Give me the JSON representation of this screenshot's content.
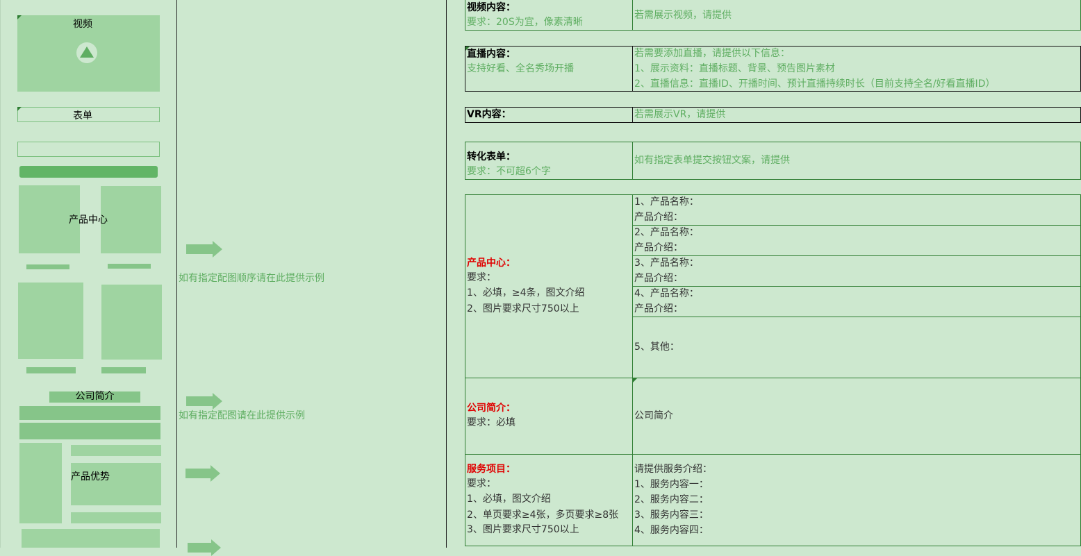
{
  "left": {
    "video_label": "视频",
    "form_label": "表单",
    "product_center_label": "产品中心",
    "company_label": "公司简介",
    "advantage_label": "产品优势"
  },
  "middle": {
    "note_1": "如有指定配图顺序请在此提供示例",
    "note_2": "如有指定配图请在此提供示例"
  },
  "rows": {
    "video": {
      "title": "视频内容：",
      "req": "要求：20S为宜，像素清晰",
      "note": "若需展示视频，请提供"
    },
    "live": {
      "title": "直播内容：",
      "req": "支持好看、全名秀场开播",
      "lines": [
        "若需要添加直播，请提供以下信息：",
        "1、展示资料：直播标题、背景、预告图片素材",
        "2、直播信息：直播ID、开播时间、预计直播持续时长（目前支持全名/好看直播ID）"
      ]
    },
    "vr": {
      "title": "VR内容：",
      "note": "若需展示VR，请提供"
    },
    "form": {
      "title": "转化表单：",
      "req": "要求：不可超6个字",
      "note": "如有指定表单提交按钮文案，请提供"
    },
    "product": {
      "title": "产品中心：",
      "req": [
        "要求：",
        "1、必填，≥4条，图文介绍",
        "2、图片要求尺寸750以上"
      ],
      "items": [
        {
          "name": "1、产品名称：",
          "intro": "产品介绍："
        },
        {
          "name": "2、产品名称：",
          "intro": "产品介绍："
        },
        {
          "name": "3、产品名称：",
          "intro": "产品介绍："
        },
        {
          "name": "4、产品名称：",
          "intro": "产品介绍："
        }
      ],
      "other": "5、其他："
    },
    "company": {
      "title": "公司简介：",
      "req": "要求：必填",
      "note": "公司简介"
    },
    "service": {
      "title": "服务项目：",
      "req": [
        "要求：",
        "1、必填，图文介绍",
        "2、单页要求≥4张，多页要求≥8张",
        "3、图片要求尺寸750以上"
      ],
      "lines": [
        "请提供服务介绍：",
        "1、服务内容一：",
        "2、服务内容二：",
        "3、服务内容三：",
        "4、服务内容四："
      ]
    }
  }
}
